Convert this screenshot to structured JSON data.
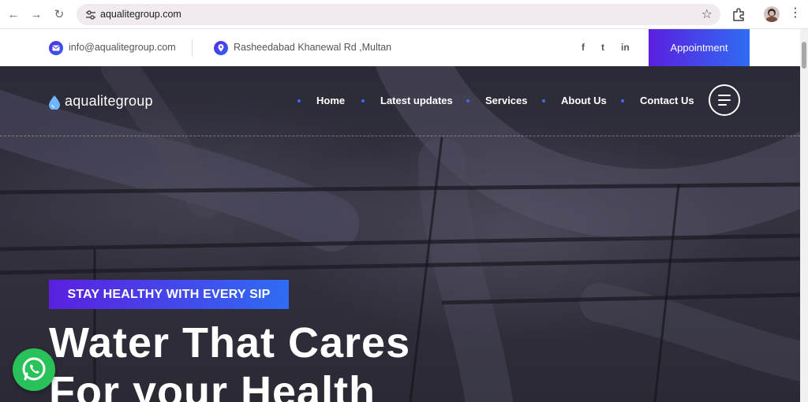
{
  "browser": {
    "back_icon": "arrow-left-icon",
    "forward_icon": "arrow-right-icon",
    "reload_icon": "reload-icon",
    "url": "aqualitegroup.com",
    "bookmark_icon": "star-icon",
    "extensions_icon": "puzzle-icon",
    "menu_icon": "kebab-icon"
  },
  "infobar": {
    "email": "info@aqualitegroup.com",
    "address": "Rasheedabad Khanewal Rd ,Multan",
    "social": [
      "f",
      "t",
      "in"
    ],
    "appointment_label": "Appointment"
  },
  "header": {
    "logo_text": "aqualitegroup",
    "nav": [
      "Home",
      "Latest updates",
      "Services",
      "About Us",
      "Contact Us"
    ]
  },
  "hero": {
    "tagline": "STAY HEALTHY WITH EVERY SIP",
    "headline_line1": "Water That Cares",
    "headline_line2": "For your Health"
  },
  "colors": {
    "accent_start": "#5b1fe0",
    "accent_end": "#2f6cf3",
    "whatsapp": "#29c15a"
  }
}
